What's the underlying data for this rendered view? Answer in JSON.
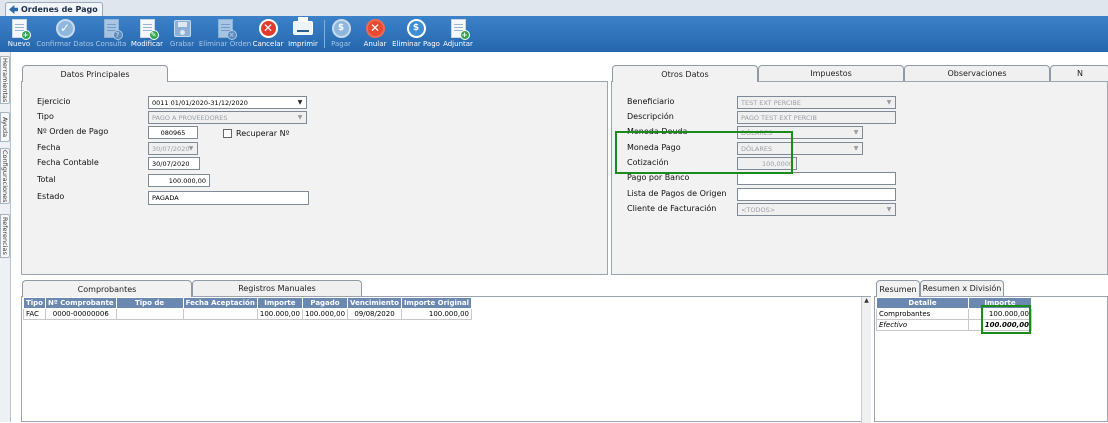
{
  "window": {
    "tab_title": "Ordenes de Pago"
  },
  "toolbar": [
    {
      "label": "Nuevo",
      "icon": "new-doc-icon",
      "enabled": true
    },
    {
      "label": "Confirmar Datos",
      "icon": "check-icon",
      "enabled": false
    },
    {
      "label": "Consulta",
      "icon": "query-icon",
      "enabled": false
    },
    {
      "label": "Modificar",
      "icon": "edit-icon",
      "enabled": true
    },
    {
      "label": "Grabar",
      "icon": "save-icon",
      "enabled": false
    },
    {
      "label": "Eliminar Orden",
      "icon": "delete-doc-icon",
      "enabled": false
    },
    {
      "label": "Cancelar",
      "icon": "cancel-icon",
      "enabled": true
    },
    {
      "label": "Imprimir",
      "icon": "printer-icon",
      "enabled": true
    },
    {
      "label": "Pagar",
      "icon": "pay-icon",
      "enabled": false
    },
    {
      "label": "Anular",
      "icon": "void-icon",
      "enabled": true
    },
    {
      "label": "Eliminar Pago",
      "icon": "delete-payment-icon",
      "enabled": true
    },
    {
      "label": "Adjuntar",
      "icon": "attach-icon",
      "enabled": true
    }
  ],
  "sidebar": [
    "Herramientas",
    "Ayuda",
    "Configuraciones",
    "Referencias"
  ],
  "datos_principales": {
    "tab": "Datos Principales",
    "ejercicio_label": "Ejercicio",
    "ejercicio": "0011 01/01/2020-31/12/2020",
    "tipo_label": "Tipo",
    "tipo": "PAGO A PROVEEDORES",
    "orden_label": "Nº Orden de Pago",
    "orden": "080965",
    "recuperar_label": "Recuperar Nº",
    "fecha_label": "Fecha",
    "fecha": "30/07/2020",
    "fecha_contable_label": "Fecha Contable",
    "fecha_contable": "30/07/2020",
    "total_label": "Total",
    "total": "100.000,00",
    "estado_label": "Estado",
    "estado": "PAGADA"
  },
  "top_tabs": [
    "Otros Datos",
    "Impuestos",
    "Observaciones",
    "N"
  ],
  "otros_datos": {
    "beneficiario_label": "Beneficiario",
    "beneficiario": "TEST EXT PERCIBE",
    "descripcion_label": "Descripción",
    "descripcion": "PAGO TEST EXT PERCIB",
    "moneda_deuda_label": "Moneda Deuda",
    "moneda_deuda": "DÓLARES",
    "moneda_pago_label": "Moneda Pago",
    "moneda_pago": "DÓLARES",
    "cotizacion_label": "Cotización",
    "cotizacion": "100,0000",
    "pago_banco_label": "Pago por Banco",
    "pago_banco": "",
    "lista_pagos_label": "Lista de Pagos de Origen",
    "lista_pagos": "",
    "cliente_label": "Cliente de Facturación",
    "cliente": "<TODOS>"
  },
  "bottom_tabs": [
    "Comprobantes",
    "Registros Manuales"
  ],
  "comprobantes": {
    "columns": [
      "Tipo",
      "Nº Comprobante",
      "Tipo de",
      "Fecha Aceptación",
      "Importe",
      "Pagado",
      "Vencimiento",
      "Importe Original"
    ],
    "rows": [
      [
        "FAC",
        "0000-00000006",
        "",
        "",
        "100.000,00",
        "100.000,00",
        "09/08/2020",
        "100.000,00"
      ]
    ]
  },
  "resumen_tabs": [
    "Resumen",
    "Resumen x División"
  ],
  "resumen": {
    "columns": [
      "Detalle",
      "Importe"
    ],
    "rows": [
      [
        "Comprobantes",
        "100.000,00"
      ],
      [
        "Efectivo",
        "100.000,00"
      ]
    ]
  },
  "colors": {
    "toolbar": "#2e74bb",
    "highlight": "#1b8c1b",
    "grid_header": "#6a88b0"
  }
}
